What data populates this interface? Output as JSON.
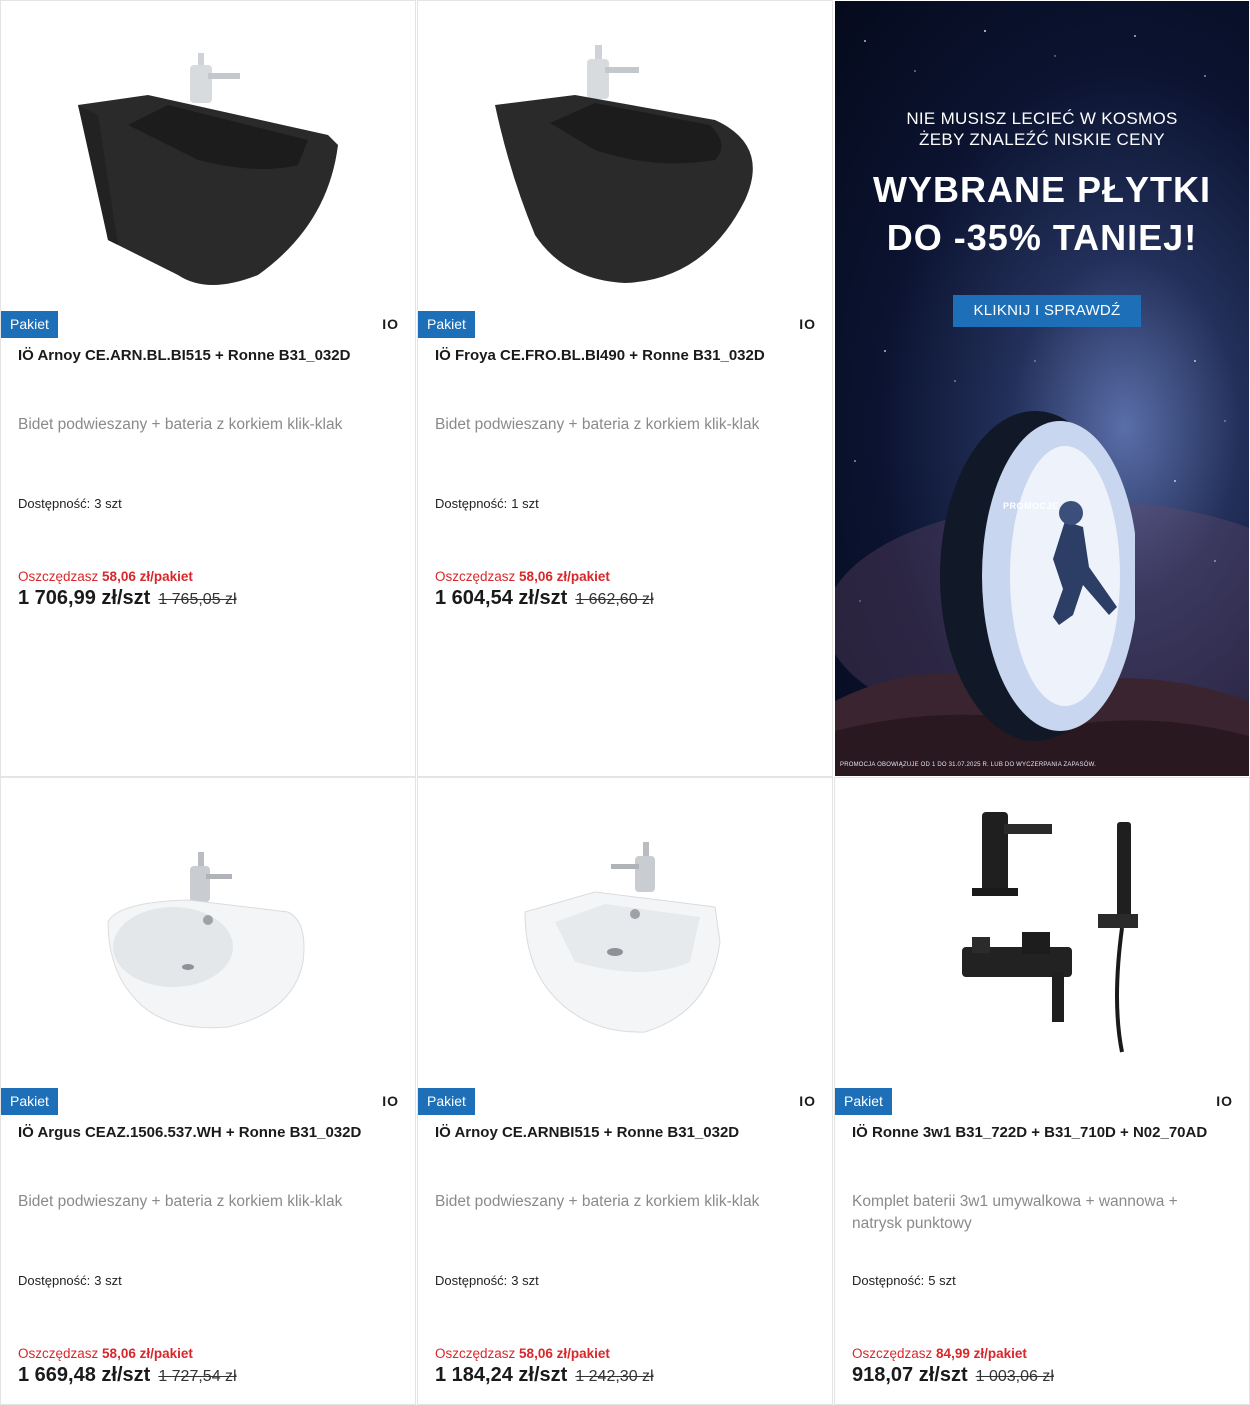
{
  "colors": {
    "accent": "#1d6fb8",
    "savings": "#d9262a",
    "text": "#1a1a1a",
    "muted": "#8a8a8a"
  },
  "products": [
    {
      "badge": "Pakiet",
      "brand": "IO",
      "title": "IÖ Arnoy CE.ARN.BL.BI515 + Ronne B31_032D",
      "description": "Bidet podwieszany + bateria z korkiem klik-klak",
      "availability_label": "Dostępność:",
      "availability_value": "3 szt",
      "savings_label": "Oszczędzasz",
      "savings_value": "58,06 zł/pakiet",
      "price": "1 706,99 zł/szt",
      "old_price": "1 765,05 zł",
      "image": "black-square-bidet"
    },
    {
      "badge": "Pakiet",
      "brand": "IO",
      "title": "IÖ Froya CE.FRO.BL.BI490 + Ronne B31_032D",
      "description": "Bidet podwieszany + bateria z korkiem klik-klak",
      "availability_label": "Dostępność:",
      "availability_value": "1 szt",
      "savings_label": "Oszczędzasz",
      "savings_value": "58,06 zł/pakiet",
      "price": "1 604,54 zł/szt",
      "old_price": "1 662,60 zł",
      "image": "black-round-bidet"
    },
    {
      "badge": "Pakiet",
      "brand": "IO",
      "title": "IÖ Argus CEAZ.1506.537.WH + Ronne B31_032D",
      "description": "Bidet podwieszany + bateria z korkiem klik-klak",
      "availability_label": "Dostępność:",
      "availability_value": "3 szt",
      "savings_label": "Oszczędzasz",
      "savings_value": "58,06 zł/pakiet",
      "price": "1 669,48 zł/szt",
      "old_price": "1 727,54 zł",
      "image": "white-round-bidet"
    },
    {
      "badge": "Pakiet",
      "brand": "IO",
      "title": "IÖ Arnoy CE.ARNBI515 + Ronne B31_032D",
      "description": "Bidet podwieszany + bateria z korkiem klik-klak",
      "availability_label": "Dostępność:",
      "availability_value": "3 szt",
      "savings_label": "Oszczędzasz",
      "savings_value": "58,06 zł/pakiet",
      "price": "1 184,24 zł/szt",
      "old_price": "1 242,30 zł",
      "image": "white-square-bidet"
    },
    {
      "badge": "Pakiet",
      "brand": "IO",
      "title": "IÖ Ronne 3w1 B31_722D + B31_710D + N02_70AD",
      "description": "Komplet baterii 3w1 umywalkowa + wannowa + natrysk punktowy",
      "availability_label": "Dostępność:",
      "availability_value": "5 szt",
      "savings_label": "Oszczędzasz",
      "savings_value": "84,99 zł/pakiet",
      "price": "918,07 zł/szt",
      "old_price": "1 003,06 zł",
      "image": "black-faucet-set"
    }
  ],
  "banner": {
    "line1": "NIE MUSISZ LECIEĆ W KOSMOS",
    "line2": "ŻEBY ZNALEŹĆ NISKIE CENY",
    "headline1": "WYBRANE PŁYTKI",
    "headline2": "DO -35% TANIEJ!",
    "button": "KLIKNIJ I SPRAWDŹ",
    "portal_label": "PROMOCJE",
    "footnote": "PROMOCJA OBOWIĄZUJE OD 1 DO 31.07.2025 R. LUB DO WYCZERPANIA ZAPASÓW."
  }
}
